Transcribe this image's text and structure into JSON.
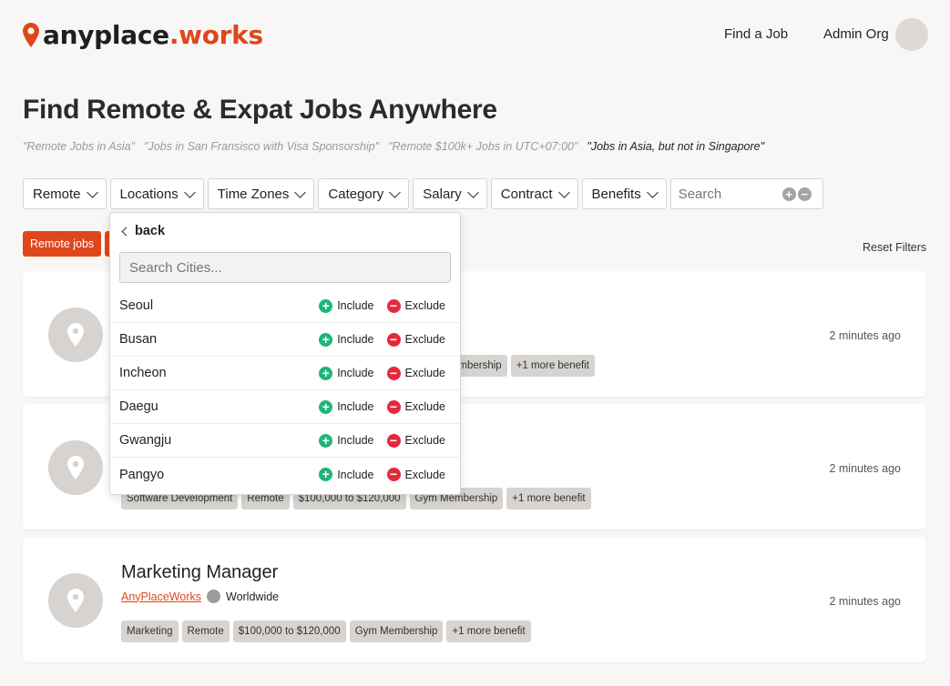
{
  "header": {
    "logo_part1": "anyplace",
    "logo_part2": ".works",
    "find_job": "Find a Job",
    "admin": "Admin Org"
  },
  "page": {
    "title": "Find Remote & Expat Jobs Anywhere",
    "examples": [
      "\"Remote Jobs in Asia\"",
      "\"Jobs in San Fransisco with Visa Sponsorship\"",
      "\"Remote $100k+ Jobs in UTC+07:00\"",
      "\"Jobs in Asia, but not in Singapore\""
    ]
  },
  "filters": {
    "remote": "Remote",
    "locations": "Locations",
    "timezones": "Time Zones",
    "category": "Category",
    "salary": "Salary",
    "contract": "Contract",
    "benefits": "Benefits",
    "search_placeholder": "Search",
    "chip": "Remote jobs",
    "reset": "Reset Filters"
  },
  "dropdown": {
    "back": "back",
    "search_placeholder": "Search Cities...",
    "include": "Include",
    "exclude": "Exclude",
    "cities": [
      "Seoul",
      "Busan",
      "Incheon",
      "Daegu",
      "Gwangju",
      "Pangyo"
    ]
  },
  "jobs": [
    {
      "time": "2 minutes ago",
      "tags": [
        "embership",
        "+1 more benefit"
      ]
    },
    {
      "time": "2 minutes ago",
      "tags": [
        "Software Development",
        "Remote",
        "$100,000 to $120,000",
        "Gym Membership",
        "+1 more benefit"
      ]
    },
    {
      "title": "Marketing Manager",
      "company": "AnyPlaceWorks",
      "location": "Worldwide",
      "time": "2 minutes ago",
      "tags": [
        "Marketing",
        "Remote",
        "$100,000 to $120,000",
        "Gym Membership",
        "+1 more benefit"
      ]
    }
  ],
  "colors": {
    "accent": "#e0461c",
    "include": "#1fb57a",
    "exclude": "#e5293c"
  }
}
